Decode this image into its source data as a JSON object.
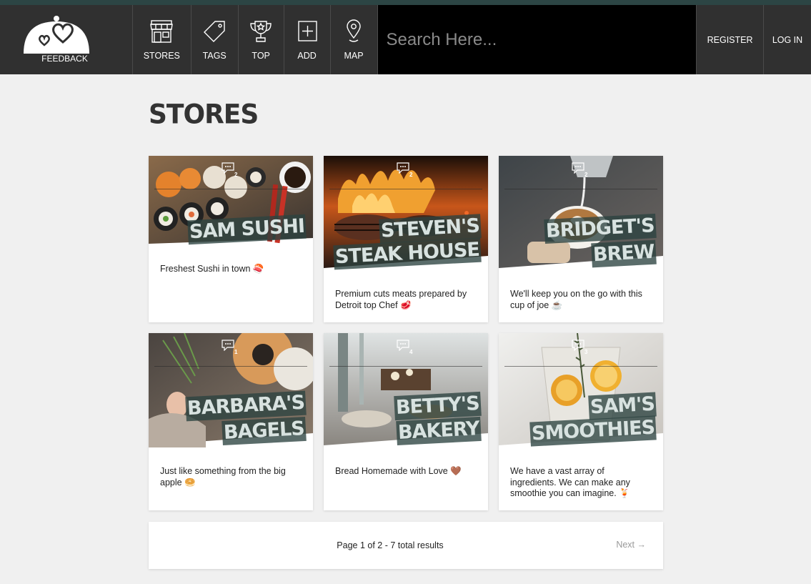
{
  "brand": {
    "logo_text": "FEEDBACK"
  },
  "nav": {
    "items": [
      {
        "label": "STORES",
        "icon": "store-icon"
      },
      {
        "label": "TAGS",
        "icon": "tag-icon"
      },
      {
        "label": "TOP",
        "icon": "trophy-icon"
      },
      {
        "label": "ADD",
        "icon": "add-icon"
      },
      {
        "label": "MAP",
        "icon": "map-pin-icon"
      }
    ],
    "search_placeholder": "Search Here...",
    "register_label": "REGISTER",
    "login_label": "LOG IN"
  },
  "page": {
    "title": "STORES"
  },
  "stores": [
    {
      "name_lines": [
        "SAM SUSHI"
      ],
      "comments": "2",
      "description": "Freshest Sushi in town 🍣"
    },
    {
      "name_lines": [
        "STEVEN'S",
        "STEAK HOUSE"
      ],
      "comments": "2",
      "description": "Premium cuts meats prepared by Detroit top Chef 🥩"
    },
    {
      "name_lines": [
        "BRIDGET'S",
        "BREW"
      ],
      "comments": "2",
      "description": "We'll keep you on the go with this cup of joe ☕"
    },
    {
      "name_lines": [
        "BARBARA'S",
        "BAGELS"
      ],
      "comments": "1",
      "description": "Just like something from the big apple 🥯"
    },
    {
      "name_lines": [
        "BETTY'S",
        "BAKERY"
      ],
      "comments": "4",
      "description": "Bread Homemade with Love 🤎"
    },
    {
      "name_lines": [
        "SAM'S",
        "SMOOTHIES"
      ],
      "comments": "3",
      "description": "We have a vast array of ingredients. We can make any smoothie you can imagine. 🍹"
    }
  ],
  "pagination": {
    "info": "Page 1 of 2 - 7 total results",
    "next_label": "Next →"
  }
}
